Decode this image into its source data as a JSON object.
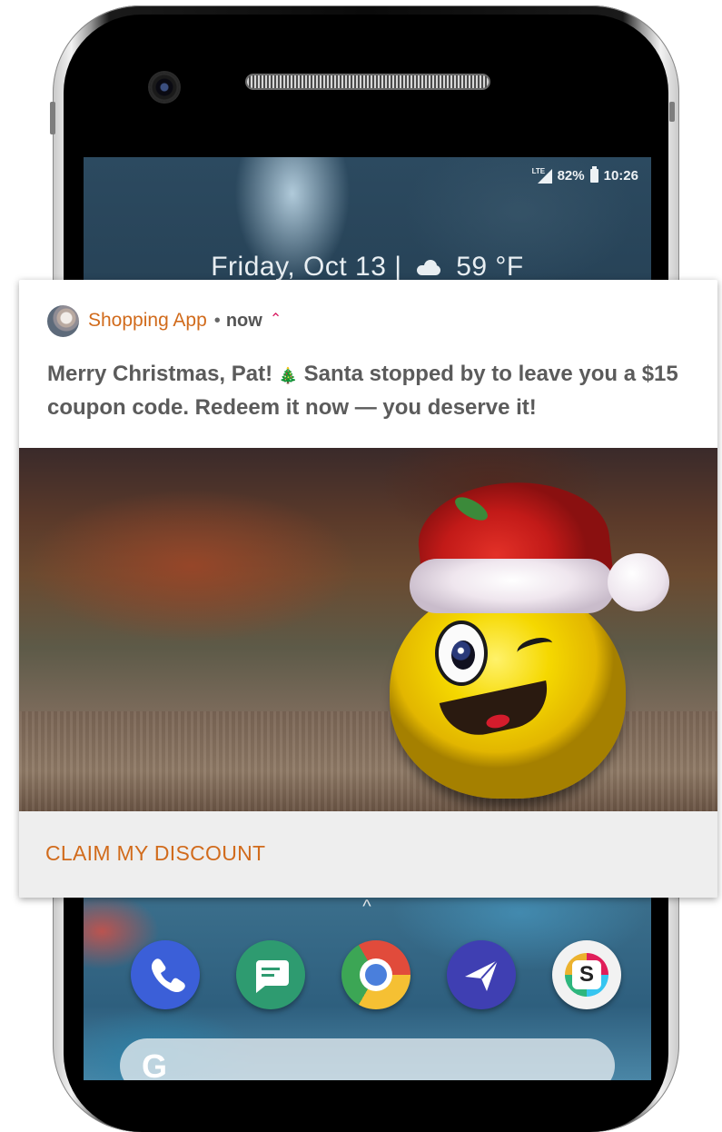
{
  "status_bar": {
    "network_label": "LTE",
    "battery": "82%",
    "time": "10:26"
  },
  "glance": {
    "date": "Friday, Oct 13 |",
    "temperature": "59 °F"
  },
  "notification": {
    "app_name": "Shopping App",
    "separator": "•",
    "time": "now",
    "expand_icon": "chevron-up-icon",
    "message_part1": "Merry Christmas, Pat!",
    "message_emoji": "🎄",
    "message_part2": "Santa stopped by to leave you a $15 coupon code. Redeem it now — you deserve it!",
    "image_description_icon": "smiley-santa-hat-image",
    "action_label": "CLAIM MY DISCOUNT"
  },
  "home": {
    "drawer_chevron": "^",
    "dock_apps": [
      "phone-icon",
      "messages-icon",
      "chrome-icon",
      "inbox-icon",
      "slack-icon"
    ],
    "search_logo": "G"
  },
  "colors": {
    "accent": "#d16b1c",
    "expand_accent": "#d8175f"
  }
}
